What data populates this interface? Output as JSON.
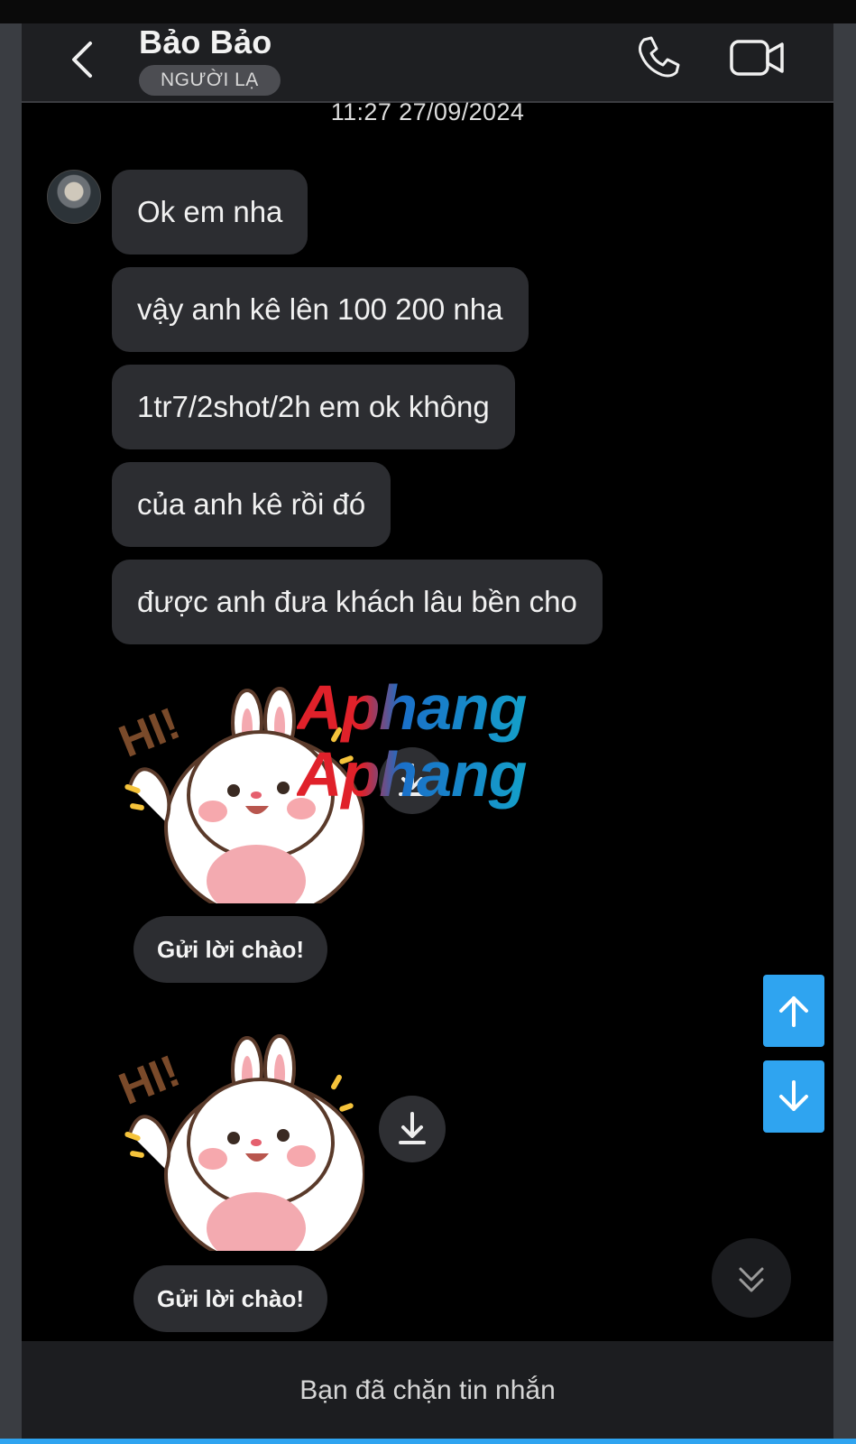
{
  "header": {
    "contact_name": "Bảo Bảo",
    "contact_badge": "NGƯỜI LẠ",
    "icons": [
      "back-icon",
      "phone-icon",
      "video-camera-icon"
    ]
  },
  "conversation": {
    "timestamp": "11:27 27/09/2024",
    "messages": [
      "Ok em nha",
      "vậy anh kê lên 100 200 nha",
      "1tr7/2shot/2h em ok không",
      "của anh kê rồi đó",
      "được anh đưa khách lâu bền cho"
    ],
    "stickers": [
      {
        "caption": "Gửi lời chào!",
        "sticker_text": "HI!"
      },
      {
        "caption": "Gửi lời chào!",
        "sticker_text": "HI!"
      }
    ]
  },
  "watermark": [
    "Aphang",
    "Aphang"
  ],
  "footer": {
    "blocked_text": "Bạn đã chặn tin nhắn"
  },
  "colors": {
    "accent": "#2fa4f0",
    "bubble": "#2c2d31",
    "header": "#1e1f22",
    "background": "#000000"
  }
}
